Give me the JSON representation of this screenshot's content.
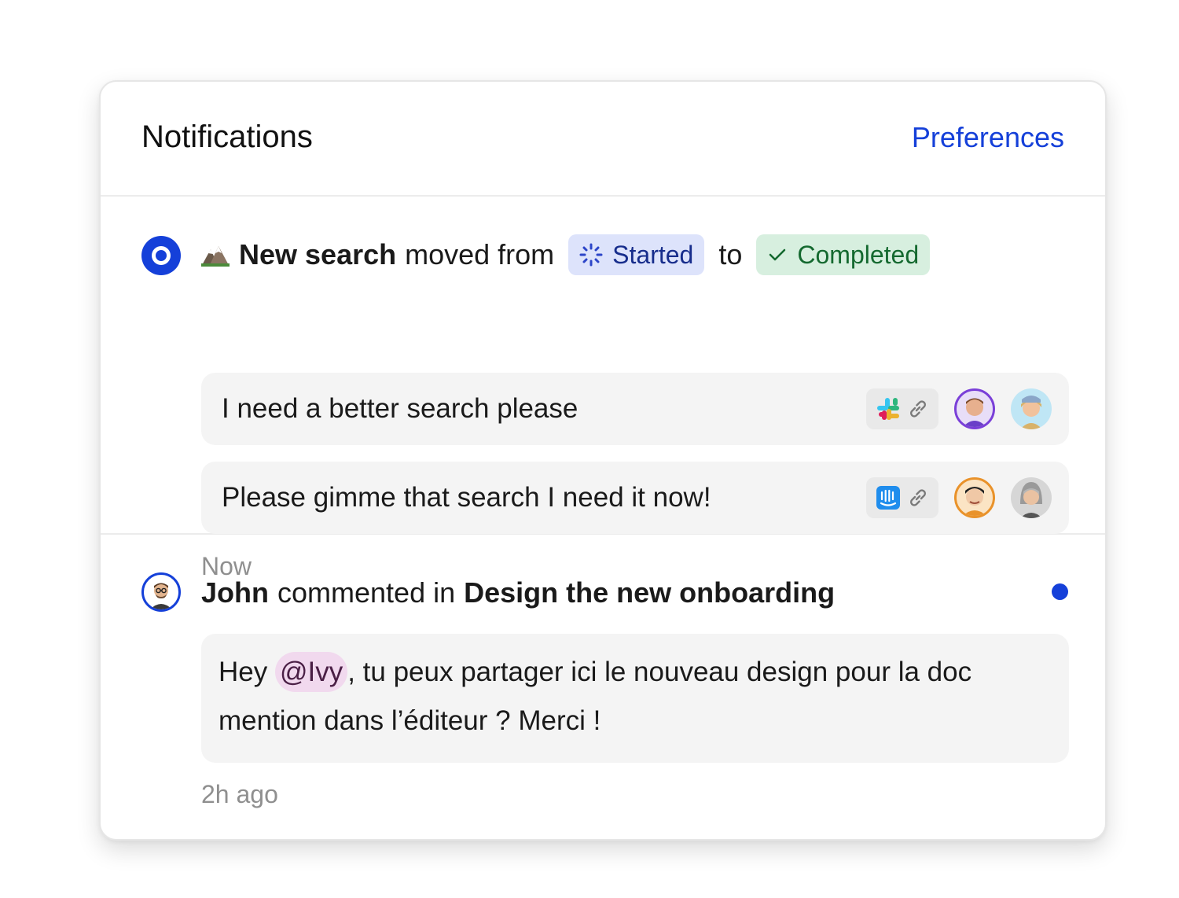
{
  "header": {
    "title": "Notifications",
    "preferences_label": "Preferences"
  },
  "notification_1": {
    "item_name": "New search",
    "action": "moved from",
    "from_status": "Started",
    "connector": "to",
    "to_status": "Completed",
    "requests": [
      {
        "text": "I need a better search please",
        "source_icon": "slack-icon"
      },
      {
        "text": "Please gimme that search I need it now!",
        "source_icon": "intercom-icon"
      }
    ],
    "time": "Now"
  },
  "notification_2": {
    "author": "John",
    "action": "commented in",
    "target": "Design the new onboarding",
    "comment_before": "Hey ",
    "mention": "@Ivy",
    "comment_after": ", tu peux partager ici le nouveau design pour la doc mention dans l’éditeur ? Merci !",
    "time": "2h ago",
    "unread": true
  },
  "colors": {
    "accent": "#1540d9",
    "started_bg": "#dde3fb",
    "completed_bg": "#d7efdf",
    "mention_bg": "#f1d9ee"
  }
}
